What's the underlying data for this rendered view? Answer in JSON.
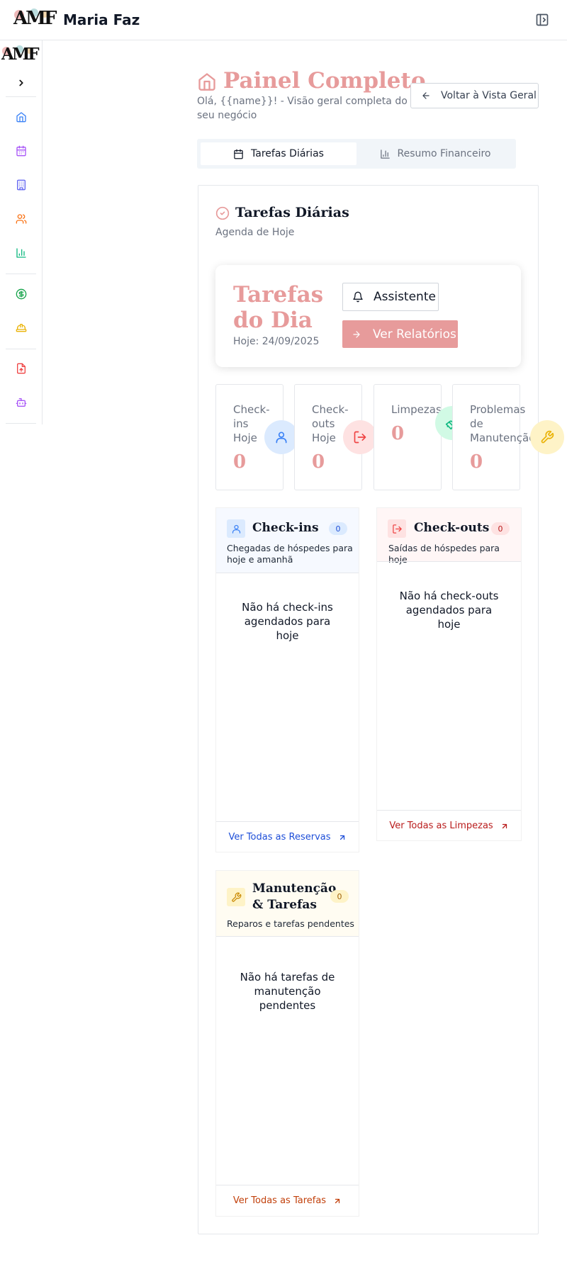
{
  "app": {
    "logo_text": "AMF",
    "brand": "Maria Faz"
  },
  "header": {
    "title": "Painel Completo",
    "subtitle": "Olá, {{name}}! - Visão geral completa do seu negócio",
    "back_button": "Voltar à Vista Geral"
  },
  "tabs": [
    {
      "label": "Tarefas Diárias",
      "active": true
    },
    {
      "label": "Resumo Financeiro",
      "active": false
    }
  ],
  "section": {
    "title": "Tarefas Diárias",
    "subtitle": "Agenda de Hoje"
  },
  "tasks_card": {
    "title": "Tarefas do Dia",
    "date": "Hoje: 24/09/2025",
    "assistant_button": "Assistente",
    "reports_button": "Ver Relatórios"
  },
  "stats": [
    {
      "label": "Check-ins Hoje",
      "value": "0",
      "icon": "user-icon",
      "color": "#3b82f6",
      "bg": "#dbeafe"
    },
    {
      "label": "Check-outs Hoje",
      "value": "0",
      "icon": "logout-icon",
      "color": "#ef4444",
      "bg": "#fee2e2"
    },
    {
      "label": "Limpezas",
      "value": "0",
      "icon": "broom-icon",
      "color": "#10b981",
      "bg": "#d1fae5"
    },
    {
      "label": "Problemas de Manutenção",
      "value": "0",
      "icon": "wrench-icon",
      "color": "#eab308",
      "bg": "#fef3c7"
    }
  ],
  "panels": {
    "checkins": {
      "title": "Check-ins",
      "count": "0",
      "subtitle": "Chegadas de hóspedes para hoje e amanhã",
      "empty": "Não há check-ins agendados para hoje",
      "link": "Ver Todas as Reservas"
    },
    "checkouts": {
      "title": "Check-outs",
      "count": "0",
      "subtitle": "Saídas de hóspedes para hoje",
      "empty": "Não há check-outs agendados para hoje",
      "link": "Ver Todas as Limpezas"
    },
    "maintenance": {
      "title": "Manutenção & Tarefas",
      "count": "0",
      "subtitle": "Reparos e tarefas pendentes",
      "empty": "Não há tarefas de manutenção pendentes",
      "link": "Ver Todas as Tarefas"
    }
  },
  "sidebar": {
    "items": [
      {
        "name": "home-icon",
        "color": "#3b82f6"
      },
      {
        "name": "calendar-icon",
        "color": "#a855f7"
      },
      {
        "name": "building-icon",
        "color": "#6366f1"
      },
      {
        "name": "users-icon",
        "color": "#f97316"
      },
      {
        "name": "bar-chart-icon",
        "color": "#10b981"
      },
      {
        "name": "dollar-icon",
        "color": "#16a34a"
      },
      {
        "name": "hardhat-icon",
        "color": "#eab308"
      },
      {
        "name": "file-upload-icon",
        "color": "#ef4444"
      },
      {
        "name": "bot-icon",
        "color": "#a855f7"
      }
    ]
  },
  "colors": {
    "accent": "#e79b9b",
    "text": "#111827",
    "muted": "#6b7280",
    "border": "#e5e7eb"
  }
}
